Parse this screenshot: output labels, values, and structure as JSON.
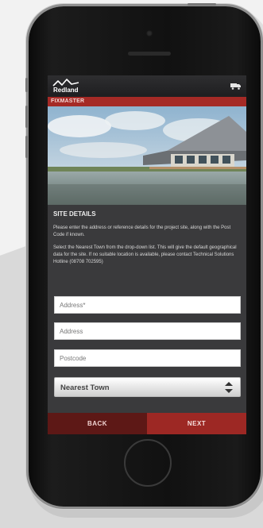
{
  "app": {
    "brand": "Redland",
    "section_title": "FIXMASTER"
  },
  "site_details": {
    "heading": "SITE DETAILS",
    "intro": "Please enter the address or reference details for the project site, along with the Post Code if known.",
    "instructions": "Select the Nearest Town from the drop-down list. This will give the default geographical data for the site. If no suitable location is available, please contact Technical Solutions Hotline (08708 702595)"
  },
  "form": {
    "address1_placeholder": "Address*",
    "address2_placeholder": "Address",
    "postcode_placeholder": "Postcode",
    "nearest_town_selected": "Nearest Town"
  },
  "nav": {
    "back_label": "BACK",
    "next_label": "NEXT"
  },
  "colors": {
    "brand_red": "#a52a26",
    "back_bg": "#5d1816",
    "next_bg": "#9d2824",
    "screen_bg": "#3a3a3c"
  },
  "icons": [
    "redland-logo-icon",
    "truck-icon",
    "select-arrows-icon"
  ]
}
